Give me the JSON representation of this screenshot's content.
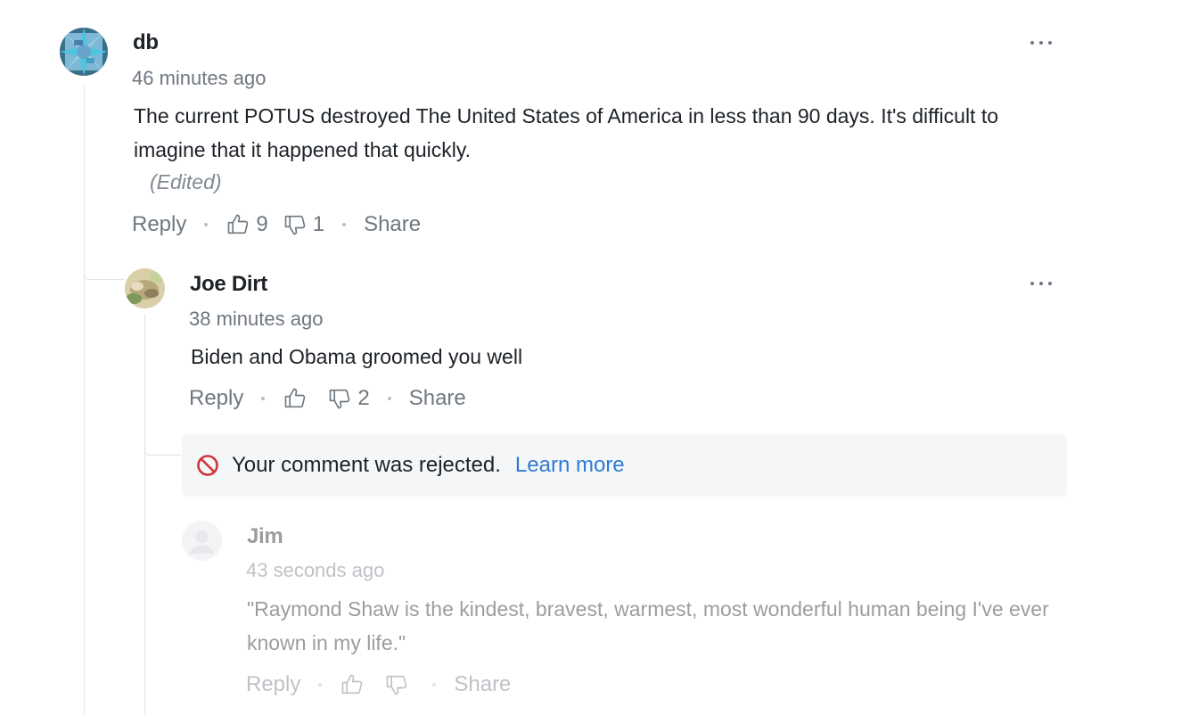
{
  "comments": [
    {
      "author": "db",
      "time": "46 minutes ago",
      "text": "The current POTUS destroyed The United States of America in less than 90 days. It's difficult to imagine that it happened that quickly.",
      "edited": "(Edited)",
      "actions": {
        "reply": "Reply",
        "likes": "9",
        "dislikes": "1",
        "share": "Share"
      }
    },
    {
      "author": "Joe Dirt",
      "time": "38 minutes ago",
      "text": "Biden and Obama groomed you well",
      "actions": {
        "reply": "Reply",
        "likes": "",
        "dislikes": "2",
        "share": "Share"
      }
    }
  ],
  "rejected": {
    "message": "Your comment was rejected.",
    "link": "Learn more",
    "author": "Jim",
    "time": "43 seconds ago",
    "text": "\"Raymond Shaw is the kindest, bravest, warmest, most wonderful human being I've ever known in my life.\"",
    "actions": {
      "reply": "Reply",
      "share": "Share"
    }
  },
  "colors": {
    "link": "#2f7ad6",
    "muted": "#6e7780",
    "reject_icon": "#d0373a"
  }
}
